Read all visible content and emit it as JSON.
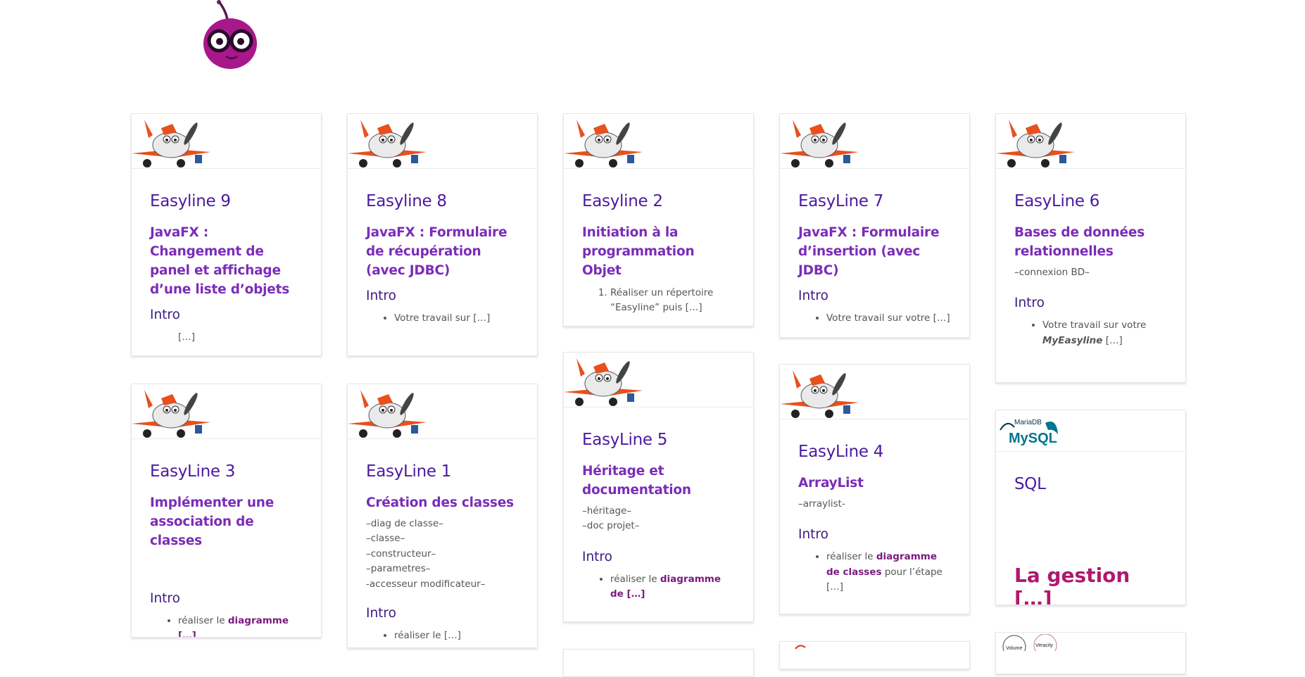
{
  "cards": [
    {
      "title": "Easyline 9",
      "subtitle": "JavaFX : Changement de panel et affichage d’une liste d’objets",
      "section": "Intro",
      "text": "[…]"
    },
    {
      "title": "Easyline 8",
      "subtitle": "JavaFX : Formulaire de récupération (avec JDBC)",
      "section": "Intro",
      "bullet": "Votre travail sur […]"
    },
    {
      "title": "Easyline 2",
      "subtitle": "Initiation à la programmation Objet",
      "list_item": "Réaliser un répertoire “Easyline” puis […]"
    },
    {
      "title": "EasyLine 7",
      "subtitle": "JavaFX : Formulaire d’insertion (avec JDBC)",
      "section": "Intro",
      "bullet": "Votre travail sur votre […]"
    },
    {
      "title": "EasyLine 6",
      "subtitle": "Bases de données relationnelles",
      "note": "–connexion BD–",
      "section": "Intro",
      "bullet_pre": "Votre travail sur votre",
      "bullet_em": "MyEasyline",
      "bullet_post": " […]"
    },
    {
      "title": "EasyLine 3",
      "subtitle": "Implémenter une association de classes",
      "section": "Intro",
      "bullet_pre": "réaliser le ",
      "bullet_link": "diagramme […]"
    },
    {
      "title": "EasyLine 1",
      "subtitle": "Création des classes",
      "lines": [
        "–diag de classe–",
        "–classe–",
        "–constructeur–",
        "–parametres–",
        "-accesseur modificateur–"
      ],
      "section": "Intro",
      "bullet": "réaliser le […]"
    },
    {
      "title": "EasyLine 5",
      "subtitle": "Héritage et documentation",
      "lines": [
        "–héritage–",
        "–doc projet–"
      ],
      "section": "Intro",
      "bullet_pre": "réaliser le ",
      "bullet_link": "diagramme de […]"
    },
    {
      "title": "EasyLine 4",
      "subtitle": "ArrayList",
      "note": "–arraylist-",
      "section": "Intro",
      "bullet_pre": "réaliser le ",
      "bullet_link": "diagramme de classes",
      "bullet_post": " pour l’étape […]"
    },
    {
      "title": "SQL",
      "highlight": "La gestion […]",
      "logo_small": "MariaDB",
      "logo_big": "MySQL"
    }
  ],
  "partial_card_labels": [
    "Volume",
    "Veracity"
  ],
  "colors": {
    "title": "#4a1aa0",
    "subtitle": "#7b2cb8",
    "link": "#7b1a80",
    "highlight": "#b0186f"
  },
  "icons": {
    "logo": "cherry-glasses-icon",
    "thumb": "plane-mascot-icon"
  }
}
